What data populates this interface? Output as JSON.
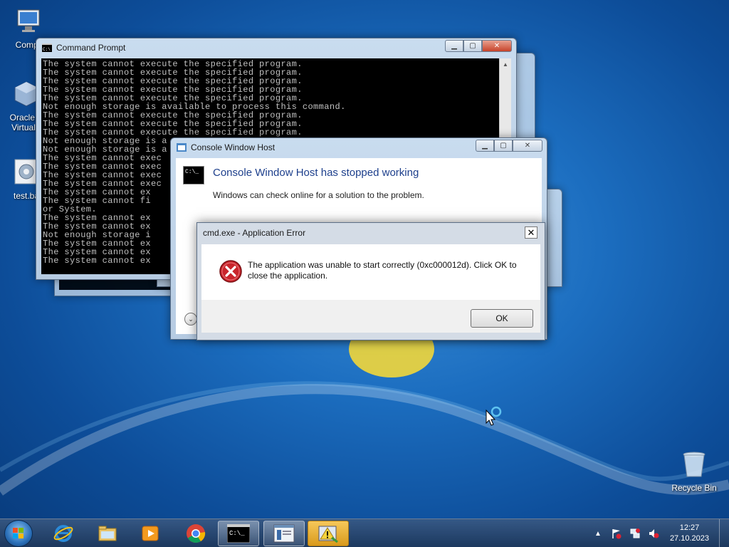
{
  "desktop": {
    "icons": [
      {
        "label": "Compu",
        "icon": "computer-icon"
      },
      {
        "label": "Oracle V",
        "label2": "VirtualB",
        "icon": "virtualbox-icon"
      },
      {
        "label": "test.ba",
        "icon": "batch-file-icon"
      },
      {
        "label": "Recycle Bin",
        "icon": "recycle-bin-icon"
      }
    ]
  },
  "cmd_window": {
    "title": "Command Prompt",
    "lines": [
      "The system cannot execute the specified program.",
      "The system cannot execute the specified program.",
      "The system cannot execute the specified program.",
      "The system cannot execute the specified program.",
      "The system cannot execute the specified program.",
      "Not enough storage is available to process this command.",
      "The system cannot execute the specified program.",
      "The system cannot execute the specified program.",
      "The system cannot execute the specified program.",
      "Not enough storage is a",
      "Not enough storage is a",
      "The system cannot exec",
      "The system cannot exec",
      "The system cannot exec",
      "The system cannot exec",
      "The system cannot ex",
      "The system cannot fi",
      "or System.",
      "The system cannot ex",
      "The system cannot ex",
      "Not enough storage i",
      "The system cannot ex",
      "The system cannot ex",
      "The system cannot ex"
    ]
  },
  "cwh_dialog": {
    "title": "Console Window Host",
    "heading": "Console Window Host has stopped working",
    "subtext": "Windows can check online for a solution to the problem.",
    "icon_text": "C:\\_"
  },
  "error_dialog": {
    "title": "cmd.exe - Application Error",
    "message": "The application was unable to start correctly (0xc000012d). Click OK to close the application.",
    "ok_label": "OK",
    "close_label": "✕"
  },
  "taskbar": {
    "clock_time": "12:27",
    "clock_date": "27.10.2023",
    "items": [
      "start-button",
      "internet-explorer-icon",
      "file-explorer-icon",
      "media-player-icon",
      "chrome-icon",
      "command-prompt-icon",
      "window-icon",
      "warning-app-icon"
    ]
  }
}
